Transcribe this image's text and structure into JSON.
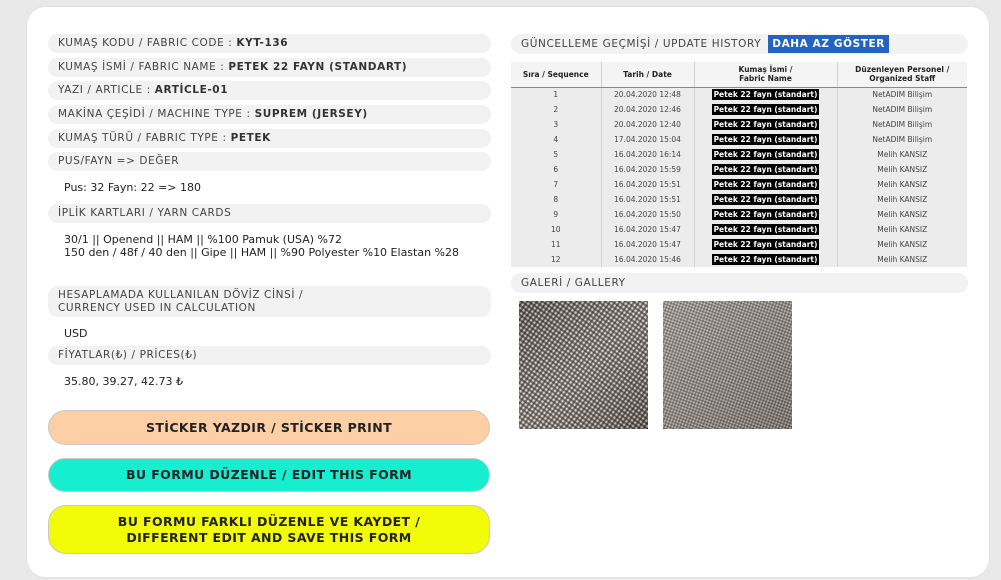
{
  "fields": {
    "code": {
      "label": "KUMAŞ KODU / FABRIC CODE :",
      "value": "KYT-136"
    },
    "name": {
      "label": "KUMAŞ İSMİ / FABRIC NAME :",
      "value": "PETEK 22 FAYN (STANDART)"
    },
    "article": {
      "label": "YAZI / ARTICLE :",
      "value": "ARTİCLE-01"
    },
    "machine": {
      "label": "MAKİNA ÇEŞİDİ / MACHINE TYPE :",
      "value": "SUPREM (JERSEY)"
    },
    "type": {
      "label": "KUMAŞ TÜRÜ / FABRIC TYPE :",
      "value": "PETEK"
    }
  },
  "pus": {
    "label": "PUS/FAYN => DEĞER",
    "value": "Pus: 32 Fayn: 22 => 180"
  },
  "yarn": {
    "label": "İPLİK KARTLARI / YARN CARDS",
    "lines": [
      "30/1 || Openend || HAM || %100 Pamuk (USA) %72",
      "150 den / 48f / 40 den || Gipe || HAM || %90 Polyester %10 Elastan %28"
    ]
  },
  "currency": {
    "label_line1": "HESAPLAMADA KULLANILAN DÖVİZ CİNSİ /",
    "label_line2": "CURRENCY USED IN CALCULATION",
    "value": "USD"
  },
  "prices": {
    "label": "FİYATLAR(₺) / PRİCES(₺)",
    "value": "35.80, 39.27, 42.73 ₺"
  },
  "buttons": {
    "sticker": "STİCKER YAZDIR / STİCKER PRINT",
    "edit": "BU FORMU DÜZENLE / EDIT THIS FORM",
    "save_line1": "BU FORMU FARKLI DÜZENLE VE KAYDET /",
    "save_line2": "DIFFERENT EDIT AND SAVE THIS FORM"
  },
  "history": {
    "title": "GÜNCELLEME GEÇMİŞİ / UPDATE HISTORY",
    "toggle": "DAHA AZ GÖSTER",
    "headers": {
      "seq": "Sıra / Sequence",
      "date": "Tarih / Date",
      "name_line1": "Kumaş İsmi /",
      "name_line2": "Fabric Name",
      "staff_line1": "Düzenleyen Personel /",
      "staff_line2": "Organized Staff"
    },
    "rows": [
      {
        "seq": "1",
        "date": "20.04.2020 12:48",
        "name": "Petek 22 fayn (standart)",
        "staff": "NetADIM Bilişim"
      },
      {
        "seq": "2",
        "date": "20.04.2020 12:46",
        "name": "Petek 22 fayn (standart)",
        "staff": "NetADIM Bilişim"
      },
      {
        "seq": "3",
        "date": "20.04.2020 12:40",
        "name": "Petek 22 fayn (standart)",
        "staff": "NetADIM Bilişim"
      },
      {
        "seq": "4",
        "date": "17.04.2020 15:04",
        "name": "Petek 22 fayn (standart)",
        "staff": "NetADIM Bilişim"
      },
      {
        "seq": "5",
        "date": "16.04.2020 16:14",
        "name": "Petek 22 fayn (standart)",
        "staff": "Melih KANSIZ"
      },
      {
        "seq": "6",
        "date": "16.04.2020 15:59",
        "name": "Petek 22 fayn (standart)",
        "staff": "Melih KANSIZ"
      },
      {
        "seq": "7",
        "date": "16.04.2020 15:51",
        "name": "Petek 22 fayn (standart)",
        "staff": "Melih KANSIZ"
      },
      {
        "seq": "8",
        "date": "16.04.2020 15:51",
        "name": "Petek 22 fayn (standart)",
        "staff": "Melih KANSIZ"
      },
      {
        "seq": "9",
        "date": "16.04.2020 15:50",
        "name": "Petek 22 fayn (standart)",
        "staff": "Melih KANSIZ"
      },
      {
        "seq": "10",
        "date": "16.04.2020 15:47",
        "name": "Petek 22 fayn (standart)",
        "staff": "Melih KANSIZ"
      },
      {
        "seq": "11",
        "date": "16.04.2020 15:47",
        "name": "Petek 22 fayn (standart)",
        "staff": "Melih KANSIZ"
      },
      {
        "seq": "12",
        "date": "16.04.2020 15:46",
        "name": "Petek 22 fayn (standart)",
        "staff": "Melih KANSIZ"
      }
    ]
  },
  "gallery": {
    "title": "GALERİ / GALLERY",
    "images": [
      "fabric-photo-dark",
      "fabric-photo-light"
    ]
  },
  "colors": {
    "sticker_button": "#fdcfa5",
    "edit_button": "#16eed0",
    "save_button": "#f2fc07",
    "toggle_button": "#2463c4"
  }
}
